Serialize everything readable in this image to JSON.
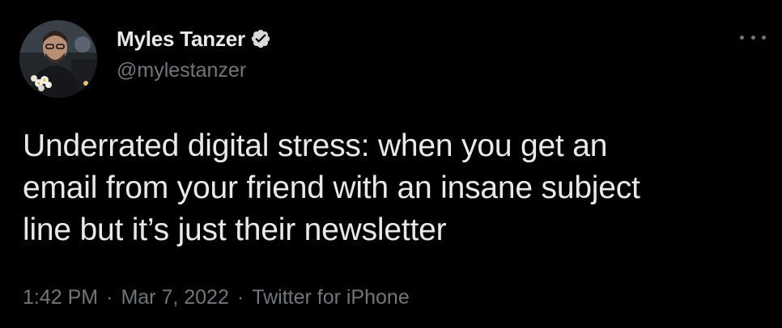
{
  "tweet": {
    "author": {
      "display_name": "Myles Tanzer",
      "handle": "@mylestanzer",
      "verified": true,
      "avatar_icon": "profile-photo"
    },
    "more_icon": "more-horizontal-icon",
    "text": "Underrated digital stress: when you get an\nemail from your friend with an insane subject\nline but it’s just their newsletter",
    "meta": {
      "time": "1:42 PM",
      "separator": "·",
      "date": "Mar 7, 2022",
      "source": "Twitter for iPhone"
    }
  },
  "colors": {
    "background": "#000000",
    "primary_text": "#e7e9ea",
    "secondary_text": "#71767b",
    "verified_badge": "#d9d9d9"
  }
}
